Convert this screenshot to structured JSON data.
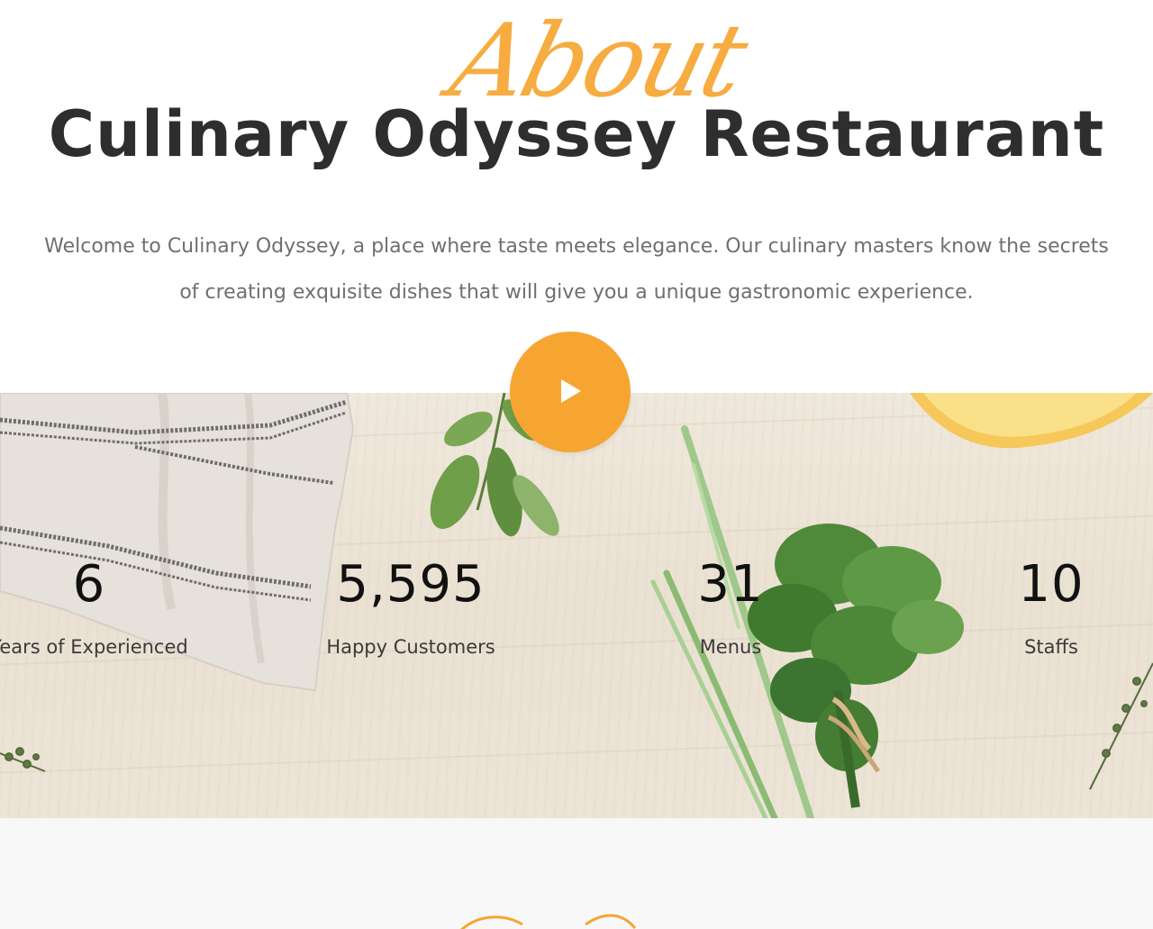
{
  "about": {
    "script_word": "About",
    "title": "Culinary Odyssey Restaurant",
    "intro_line1": "Welcome to Culinary Odyssey, a place where taste meets elegance. Our culinary masters know the secrets",
    "intro_line2": "of creating exquisite dishes that will give you a unique gastronomic experience."
  },
  "play_button": {
    "icon": "play-icon",
    "color": "#f7a531"
  },
  "stats": [
    {
      "value": "6",
      "label": "Years of Experienced"
    },
    {
      "value": "5,595",
      "label": "Happy Customers"
    },
    {
      "value": "31",
      "label": "Menus"
    },
    {
      "value": "10",
      "label": "Staffs"
    }
  ],
  "colors": {
    "accent": "#f7a531",
    "title": "#2e2e2e",
    "body_text": "#6f6f6f"
  }
}
